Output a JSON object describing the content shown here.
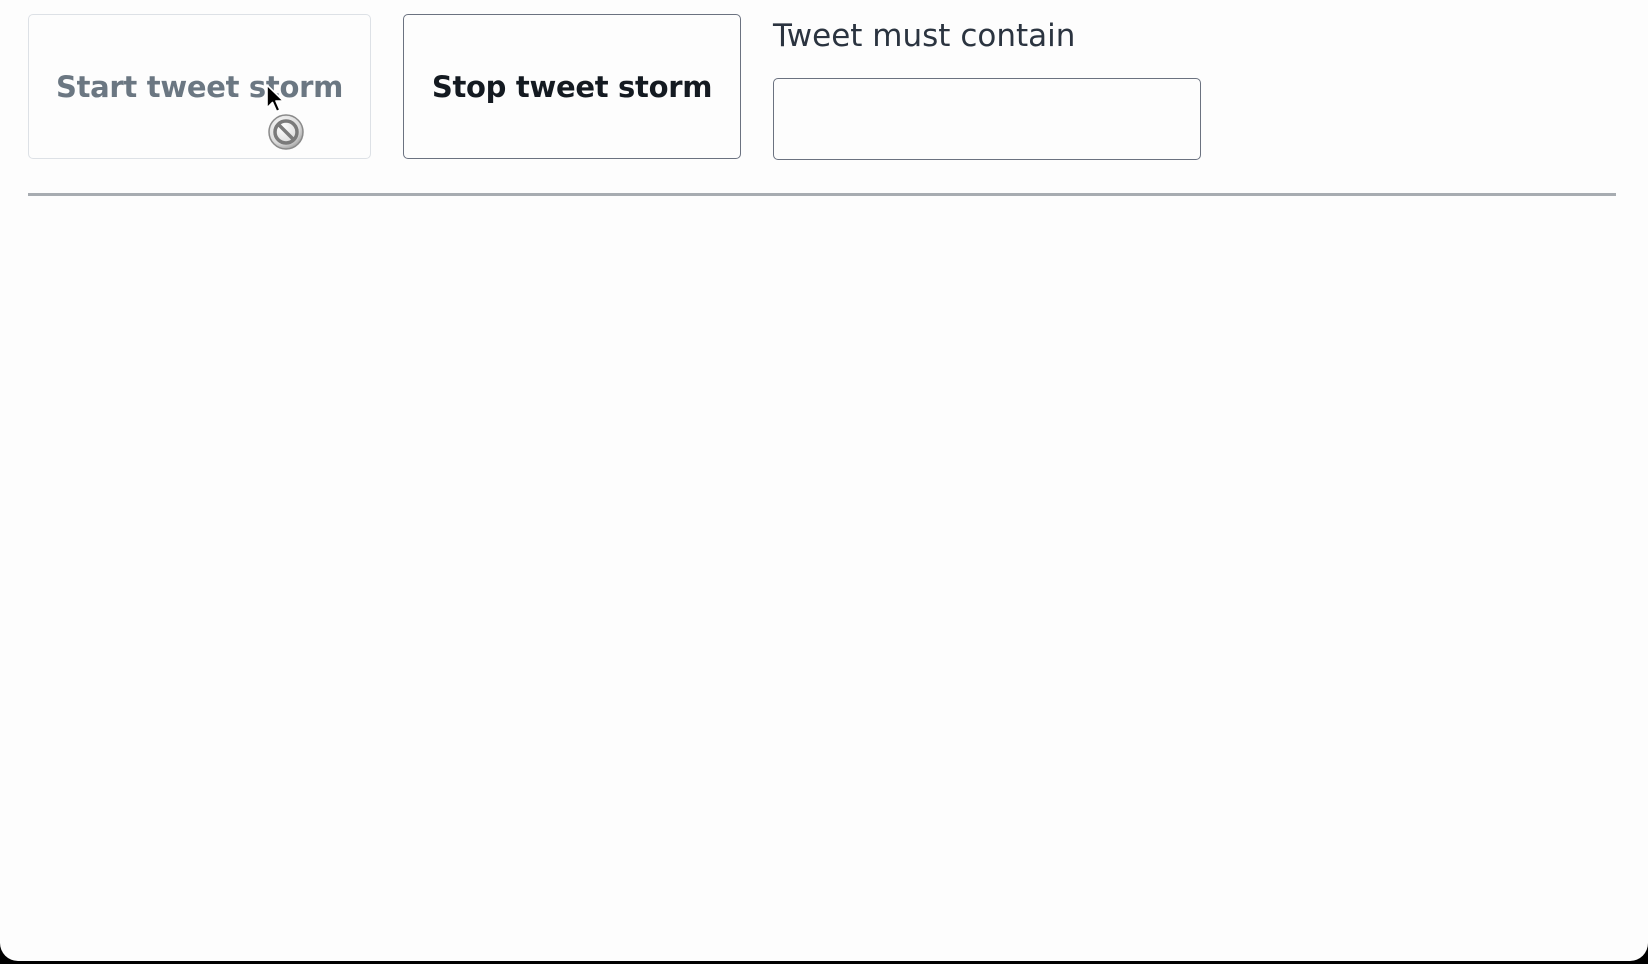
{
  "controls": {
    "start_label": "Start tweet storm",
    "start_disabled": true,
    "stop_label": "Stop tweet storm",
    "filter_label": "Tweet must contain",
    "filter_value": "",
    "filter_placeholder": ""
  },
  "feed": {
    "items": []
  },
  "pointer": {
    "cursor_icon": "arrow-cursor-icon",
    "badge_icon": "not-allowed-icon"
  }
}
